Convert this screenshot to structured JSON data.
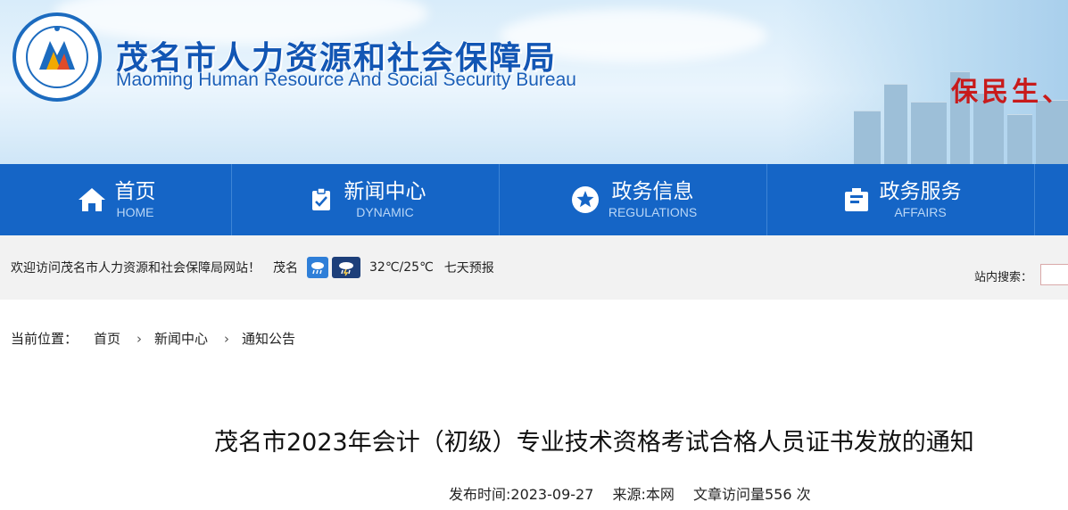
{
  "header": {
    "title_cn": "茂名市人力资源和社会保障局",
    "title_en": "Maoming Human Resource And Social Security Bureau",
    "slogan": "保民生、",
    "logo_icon": "bureau-emblem-icon"
  },
  "nav": {
    "items": [
      {
        "cn": "首页",
        "en": "HOME",
        "icon": "home-icon"
      },
      {
        "cn": "新闻中心",
        "en": "DYNAMIC",
        "icon": "clipboard-check-icon"
      },
      {
        "cn": "政务信息",
        "en": "REGULATIONS",
        "icon": "star-circle-icon"
      },
      {
        "cn": "政务服务",
        "en": "AFFAIRS",
        "icon": "service-icon"
      }
    ]
  },
  "infobar": {
    "welcome": "欢迎访问茂名市人力资源和社会保障局网站！",
    "city": "茂名",
    "weather_icons": [
      "rain-icon",
      "thunder-rain-icon"
    ],
    "temperature": "32℃/25℃",
    "forecast": "七天预报",
    "search_label": "站内搜索："
  },
  "breadcrumb": {
    "label": "当前位置：",
    "items": [
      "首页",
      "新闻中心",
      "通知公告"
    ]
  },
  "article": {
    "title": "茂名市2023年会计（初级）专业技术资格考试合格人员证书发放的通知",
    "publish": "发布时间:2023-09-27",
    "source": "来源:本网",
    "visits": "文章访问量556 次"
  },
  "colors": {
    "nav_bg": "#1565c6",
    "title_blue": "#1256b4",
    "slogan_red": "#c81b1b"
  }
}
